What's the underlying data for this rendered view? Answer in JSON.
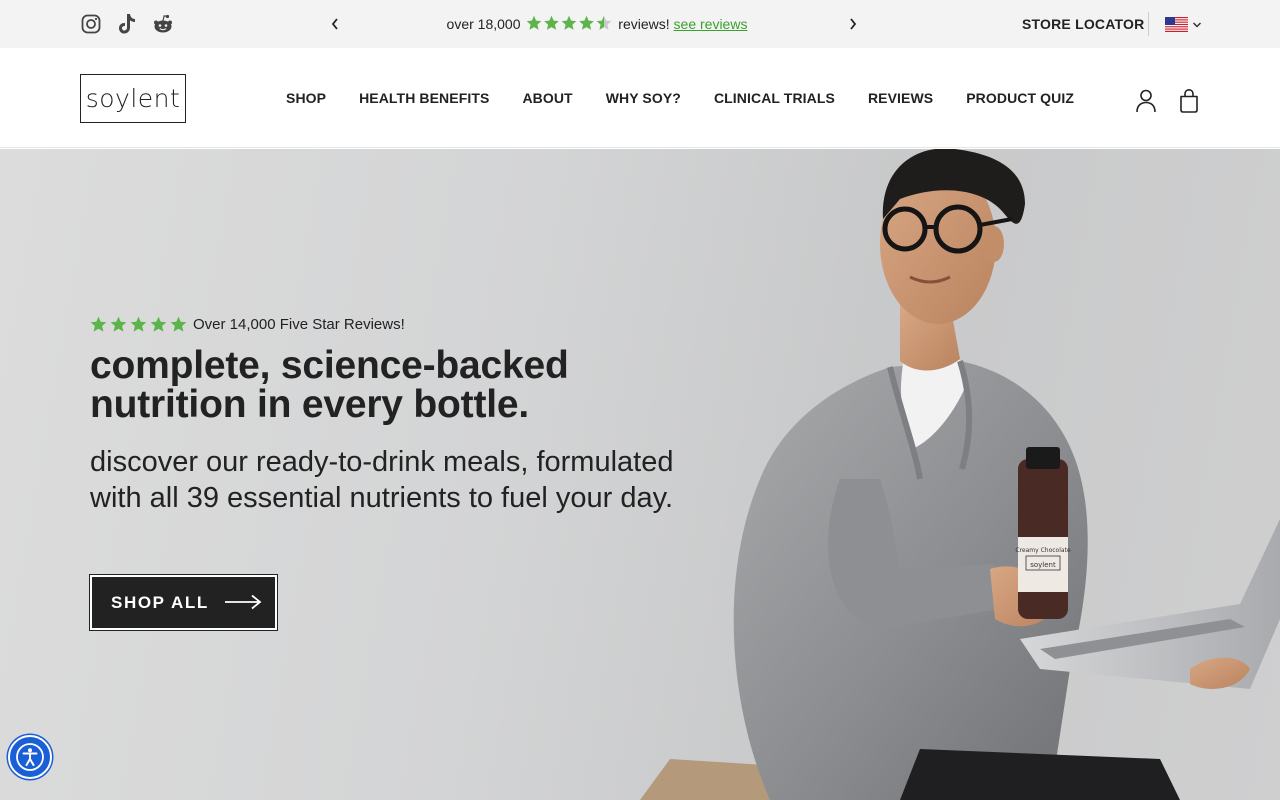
{
  "announcement": {
    "prefix": "over 18,000",
    "suffix": "reviews!",
    "link": "see reviews",
    "rating": 4.5,
    "star_color": "#5cb54a",
    "link_color": "#3aa12e"
  },
  "social": {
    "icons": [
      "instagram-icon",
      "tiktok-icon",
      "reddit-icon"
    ]
  },
  "utility": {
    "store_locator": "STORE LOCATOR",
    "country": "US"
  },
  "header": {
    "logo": "soylent",
    "nav": [
      "SHOP",
      "HEALTH BENEFITS",
      "ABOUT",
      "WHY SOY?",
      "CLINICAL TRIALS",
      "REVIEWS",
      "PRODUCT QUIZ"
    ]
  },
  "hero": {
    "reviews_text": "Over 14,000 Five Star Reviews!",
    "title": "complete, science-backed nutrition in every bottle.",
    "subtitle": "discover our ready-to-drink meals, formulated with all 39 essential nutrients to fuel your day.",
    "cta": "SHOP ALL",
    "bottle_label": "Creamy Chocolate",
    "bottle_brand": "soylent",
    "rating": 5
  },
  "accessibility": {
    "icon": "accessibility-icon",
    "color": "#1a5fd6"
  }
}
